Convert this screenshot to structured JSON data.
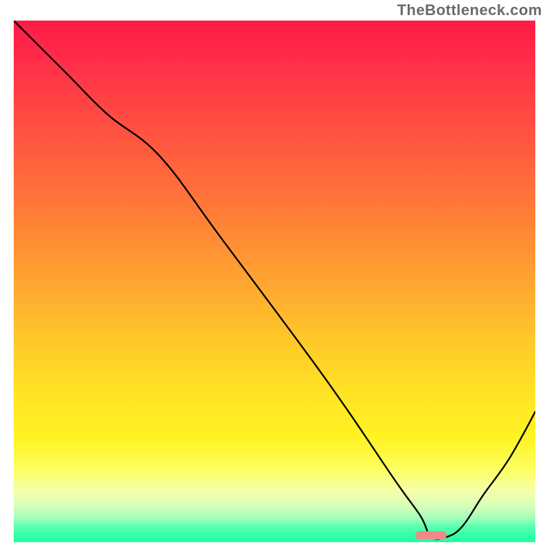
{
  "watermark": "TheBottleneck.com",
  "chart_data": {
    "type": "line",
    "title": "",
    "xlabel": "",
    "ylabel": "",
    "xlim": [
      0,
      100
    ],
    "ylim": [
      0,
      100
    ],
    "grid": false,
    "legend": false,
    "series": [
      {
        "name": "bottleneck-curve",
        "x": [
          0,
          10,
          18,
          28,
          40,
          60,
          73,
          78,
          80,
          83,
          86,
          90,
          95,
          100
        ],
        "values": [
          100,
          90,
          82,
          74,
          58,
          31,
          12,
          5,
          1,
          1,
          3,
          9,
          16,
          25
        ]
      }
    ],
    "marker": {
      "name": "optimal-range-marker",
      "x": 80,
      "y": 1.3,
      "width": 6,
      "color": "#f08a8a"
    },
    "background": "vertical-gradient red→yellow→green",
    "annotations": []
  }
}
